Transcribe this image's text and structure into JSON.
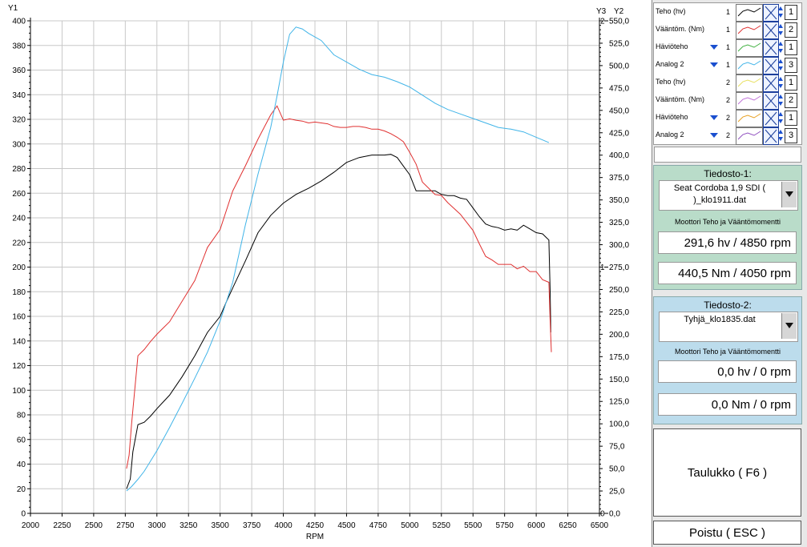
{
  "chart_data": {
    "type": "line",
    "xlabel": "RPM",
    "y1label": "Y1",
    "y2label": "Y2",
    "y3label": "Y3",
    "xlim": [
      2000,
      6500
    ],
    "y1lim": [
      0,
      400
    ],
    "y2lim": [
      0,
      550
    ],
    "y3lim": [
      0,
      2
    ],
    "x_ticks": [
      2000,
      2250,
      2500,
      2750,
      3000,
      3250,
      3500,
      3750,
      4000,
      4250,
      4500,
      4750,
      5000,
      5250,
      5500,
      5750,
      6000,
      6250,
      6500
    ],
    "y1_ticks": [
      0,
      20,
      40,
      60,
      80,
      100,
      120,
      140,
      160,
      180,
      200,
      220,
      240,
      260,
      280,
      300,
      320,
      340,
      360,
      380,
      400
    ],
    "y2_ticks": [
      "0,0",
      "25,0",
      "50,0",
      "75,0",
      "100,0",
      "125,0",
      "150,0",
      "175,0",
      "200,0",
      "225,0",
      "250,0",
      "275,0",
      "300,0",
      "325,0",
      "350,0",
      "375,0",
      "400,0",
      "425,0",
      "450,0",
      "475,0",
      "500,0",
      "525,0",
      "550,0"
    ],
    "y3_ticks": [
      {
        "label": "0",
        "value": 0
      },
      {
        "label": "1",
        "value": 1
      },
      {
        "label": "2",
        "value": 2
      }
    ],
    "grid": true,
    "series": [
      {
        "name": "Teho (hv)",
        "color": "#000000",
        "axis": "y1",
        "x": [
          2760,
          2790,
          2810,
          2850,
          2900,
          2950,
          3000,
          3100,
          3200,
          3300,
          3400,
          3500,
          3550,
          3600,
          3700,
          3800,
          3900,
          4000,
          4100,
          4200,
          4300,
          4400,
          4500,
          4600,
          4700,
          4750,
          4800,
          4850,
          4900,
          4950,
          5000,
          5050,
          5100,
          5150,
          5200,
          5250,
          5300,
          5350,
          5400,
          5450,
          5500,
          5550,
          5600,
          5650,
          5700,
          5750,
          5800,
          5850,
          5900,
          5950,
          6000,
          6050,
          6080,
          6100,
          6110,
          6115
        ],
        "values": [
          20,
          28,
          50,
          72,
          74,
          79,
          85,
          96,
          111,
          128,
          147,
          160,
          172,
          183,
          205,
          228,
          242,
          252,
          259,
          264,
          270,
          277,
          285,
          289,
          291,
          291,
          291,
          291.6,
          289,
          282,
          275,
          262,
          262,
          262,
          262,
          259,
          258,
          258,
          256,
          255,
          248,
          241,
          235,
          233,
          232,
          230,
          231,
          230,
          234,
          231,
          228,
          227,
          224,
          222,
          180,
          147
        ]
      },
      {
        "name": "Vääntöm. (Nm)",
        "color": "#e03030",
        "axis": "y2",
        "x": [
          2760,
          2780,
          2800,
          2850,
          2900,
          2950,
          3000,
          3050,
          3100,
          3200,
          3300,
          3400,
          3500,
          3600,
          3700,
          3800,
          3900,
          3950,
          4000,
          4050,
          4100,
          4150,
          4200,
          4250,
          4300,
          4350,
          4400,
          4450,
          4500,
          4550,
          4600,
          4650,
          4700,
          4750,
          4800,
          4850,
          4900,
          4950,
          5000,
          5050,
          5100,
          5200,
          5250,
          5300,
          5400,
          5500,
          5550,
          5600,
          5650,
          5700,
          5800,
          5850,
          5900,
          5950,
          6000,
          6050,
          6100,
          6110,
          6120
        ],
        "values": [
          50,
          65,
          100,
          176,
          183,
          192,
          200,
          207,
          214,
          237,
          260,
          297,
          317,
          360,
          388,
          418,
          445,
          455,
          439,
          440.5,
          439,
          438,
          436,
          437,
          436,
          435,
          432,
          431,
          431,
          432,
          432,
          431,
          429,
          429,
          427,
          424,
          420,
          415,
          403,
          390,
          370,
          356,
          355,
          347,
          334,
          316,
          301,
          287,
          283,
          278,
          278,
          273,
          276,
          270,
          270,
          261,
          258,
          215,
          180
        ]
      },
      {
        "name": "Analog 2",
        "color": "#40b4e8",
        "axis": "y2",
        "x": [
          2760,
          2800,
          2850,
          2900,
          3000,
          3100,
          3200,
          3300,
          3400,
          3500,
          3600,
          3700,
          3800,
          3900,
          3950,
          4000,
          4050,
          4100,
          4150,
          4200,
          4300,
          4400,
          4500,
          4600,
          4700,
          4800,
          4900,
          5000,
          5100,
          5200,
          5300,
          5400,
          5500,
          5600,
          5700,
          5800,
          5900,
          6000,
          6050,
          6100
        ],
        "values": [
          25,
          30,
          38,
          47,
          70,
          96,
          123,
          151,
          180,
          215,
          258,
          322,
          379,
          431,
          466,
          504,
          535,
          543,
          541,
          536,
          528,
          512,
          504,
          496,
          490,
          487,
          482,
          476,
          467,
          458,
          451,
          446,
          441,
          436,
          431,
          429,
          426,
          420,
          417,
          414
        ]
      }
    ]
  },
  "legend": {
    "rows": [
      {
        "label": "Teho (hv)",
        "file_no": "1",
        "axis_no": "1",
        "color": "#000000",
        "marker": false
      },
      {
        "label": "Vääntöm. (Nm)",
        "file_no": "1",
        "axis_no": "2",
        "color": "#e03030",
        "marker": false
      },
      {
        "label": "Häviöteho",
        "file_no": "1",
        "axis_no": "1",
        "color": "#40b040",
        "marker": true
      },
      {
        "label": "Analog 2",
        "file_no": "1",
        "axis_no": "3",
        "color": "#40b4e8",
        "marker": true
      },
      {
        "label": "Teho (hv)",
        "file_no": "2",
        "axis_no": "1",
        "color": "#e8e060",
        "marker": false
      },
      {
        "label": "Vääntöm. (Nm)",
        "file_no": "2",
        "axis_no": "2",
        "color": "#c070d8",
        "marker": false
      },
      {
        "label": "Häviöteho",
        "file_no": "2",
        "axis_no": "1",
        "color": "#e8a020",
        "marker": true
      },
      {
        "label": "Analog 2",
        "file_no": "2",
        "axis_no": "3",
        "color": "#9050c0",
        "marker": true
      }
    ]
  },
  "file1": {
    "title": "Tiedosto-1:",
    "name_line1": "Seat Cordoba 1,9 SDI (",
    "name_line2": ")_klo1911.dat",
    "subtitle": "Moottori Teho ja Vääntömomentti",
    "power": "291,6 hv / 4850 rpm",
    "torque": "440,5 Nm / 4050 rpm"
  },
  "file2": {
    "title": "Tiedosto-2:",
    "name_line1": "Tyhjä_klo1835.dat",
    "subtitle": "Moottori Teho ja Vääntömomentti",
    "power": "0,0 hv / 0 rpm",
    "torque": "0,0 Nm / 0 rpm"
  },
  "buttons": {
    "table": "Taulukko ( F6 )",
    "exit": "Poistu ( ESC )"
  }
}
